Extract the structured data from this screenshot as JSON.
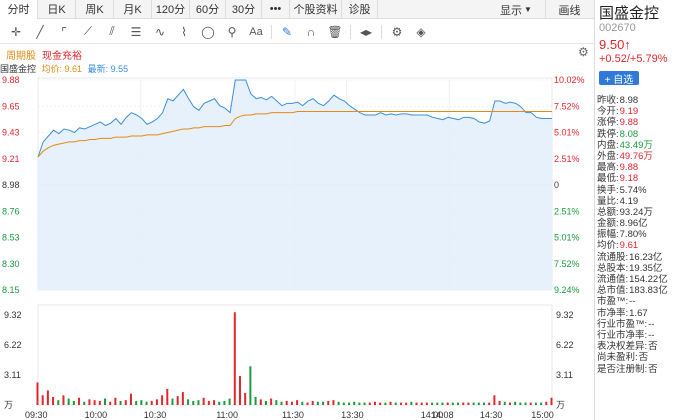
{
  "colors": {
    "up": "#e4262c",
    "down": "#1a9b3d",
    "price_line": "#3b8fdc",
    "avg_line": "#e58a17",
    "accent": "#2f7ad9"
  },
  "period_tabs": [
    {
      "label": "分时",
      "active": true
    },
    {
      "label": "日K"
    },
    {
      "label": "周K"
    },
    {
      "label": "月K"
    },
    {
      "label": "120分"
    },
    {
      "label": "60分"
    },
    {
      "label": "30分"
    },
    {
      "label": "•••"
    },
    {
      "label": "个股资料"
    },
    {
      "label": "诊股"
    }
  ],
  "display_menu": "显示",
  "draw_label": "画线",
  "toolbar_icons": [
    "crosshair-icon",
    "line-tool-icon",
    "rect-tool-icon",
    "fan-tool-icon",
    "parallel-tool-icon",
    "fib-tool-icon",
    "wave-tool-icon",
    "pen-tool-icon",
    "ellipse-tool-icon",
    "measure-tool-icon",
    "text-tool-icon",
    "highlighter-icon",
    "magnet-icon",
    "delete-icon",
    "flip-icon",
    "settings-icon",
    "layers-icon"
  ],
  "chart_head": {
    "tab1": "周期股",
    "tab2": "现金充裕",
    "gear": "⚙"
  },
  "legend": {
    "name": "国盛金控",
    "avg_label": "均价: 9.61",
    "latest_label": "最新: 9.55"
  },
  "chart_data": {
    "type": "line",
    "price_axis_left": [
      "9.88",
      "9.65",
      "9.43",
      "9.21",
      "8.98",
      "8.76",
      "8.53",
      "8.30",
      "8.15"
    ],
    "price_axis_right": [
      "10.02%",
      "7.52%",
      "5.01%",
      "2.51%",
      "0",
      "2.51%",
      "5.01%",
      "7.52%",
      "9.24%"
    ],
    "volume_axis": [
      "9.32",
      "6.22",
      "3.11",
      "万"
    ],
    "volume_axis_right": [
      "9.32",
      "6.22",
      "3.11",
      "万"
    ],
    "x_ticks": [
      "09:30",
      "10:00",
      "10:30",
      "11:00",
      "11:30",
      "13:30",
      "14:00",
      "14:08",
      "14:30",
      "15:00"
    ],
    "prev_close": 8.98,
    "ylim": [
      8.08,
      9.88
    ],
    "price_series": [
      9.22,
      9.35,
      9.4,
      9.45,
      9.42,
      9.46,
      9.45,
      9.43,
      9.47,
      9.46,
      9.48,
      9.5,
      9.52,
      9.49,
      9.51,
      9.55,
      9.5,
      9.56,
      9.6,
      9.58,
      9.55,
      9.5,
      9.52,
      9.55,
      9.6,
      9.72,
      9.7,
      9.75,
      9.8,
      9.72,
      9.65,
      9.62,
      9.68,
      9.7,
      9.72,
      9.66,
      9.64,
      9.6,
      9.88,
      9.88,
      9.88,
      9.76,
      9.72,
      9.73,
      9.71,
      9.74,
      9.7,
      9.66,
      9.68,
      9.68,
      9.69,
      9.66,
      9.7,
      9.72,
      9.68,
      9.66,
      9.7,
      9.75,
      9.72,
      9.7,
      9.66,
      9.63,
      9.6,
      9.58,
      9.58,
      9.58,
      9.6,
      9.58,
      9.59,
      9.58,
      9.59,
      9.59,
      9.58,
      9.58,
      9.58,
      9.58,
      9.56,
      9.55,
      9.54,
      9.56,
      9.55,
      9.54,
      9.56,
      9.56,
      9.55,
      9.52,
      9.51,
      9.53,
      9.7,
      9.7,
      9.68,
      9.69,
      9.68,
      9.65,
      9.6,
      9.6,
      9.56,
      9.55,
      9.55,
      9.55
    ],
    "avg_series": [
      9.22,
      9.27,
      9.3,
      9.32,
      9.33,
      9.34,
      9.35,
      9.35,
      9.36,
      9.36,
      9.37,
      9.37,
      9.38,
      9.38,
      9.38,
      9.39,
      9.39,
      9.39,
      9.4,
      9.4,
      9.4,
      9.41,
      9.41,
      9.41,
      9.42,
      9.43,
      9.44,
      9.45,
      9.46,
      9.46,
      9.47,
      9.47,
      9.48,
      9.48,
      9.48,
      9.48,
      9.49,
      9.49,
      9.55,
      9.57,
      9.58,
      9.58,
      9.59,
      9.59,
      9.59,
      9.6,
      9.6,
      9.6,
      9.6,
      9.6,
      9.61,
      9.61,
      9.61,
      9.61,
      9.61,
      9.61,
      9.61,
      9.61,
      9.61,
      9.61,
      9.61,
      9.61,
      9.61,
      9.61,
      9.61,
      9.61,
      9.61,
      9.61,
      9.61,
      9.61,
      9.61,
      9.61,
      9.61,
      9.61,
      9.61,
      9.61,
      9.61,
      9.61,
      9.61,
      9.61,
      9.61,
      9.61,
      9.61,
      9.61,
      9.61,
      9.61,
      9.61,
      9.61,
      9.61,
      9.61,
      9.61,
      9.61,
      9.61,
      9.61,
      9.61,
      9.61,
      9.61,
      9.61,
      9.61,
      9.61
    ],
    "volume_series": [
      2.8,
      1.2,
      1.8,
      1.0,
      0.6,
      1.2,
      0.8,
      0.5,
      0.9,
      0.4,
      0.7,
      0.6,
      0.5,
      0.8,
      0.4,
      0.9,
      0.5,
      0.6,
      1.4,
      0.5,
      0.6,
      0.4,
      0.5,
      0.7,
      1.2,
      2.0,
      0.8,
      1.1,
      1.6,
      0.7,
      0.5,
      0.6,
      0.9,
      0.5,
      0.6,
      0.4,
      0.5,
      0.8,
      11.5,
      3.6,
      1.5,
      4.8,
      1.0,
      0.7,
      0.5,
      0.8,
      0.6,
      0.4,
      0.5,
      0.4,
      0.6,
      0.4,
      0.3,
      0.5,
      0.4,
      0.4,
      0.5,
      0.6,
      0.4,
      0.3,
      0.3,
      0.4,
      0.3,
      0.3,
      0.3,
      0.4,
      0.3,
      0.3,
      0.4,
      0.3,
      0.3,
      0.3,
      0.4,
      0.3,
      0.3,
      0.3,
      0.3,
      0.3,
      0.3,
      0.3,
      0.3,
      0.3,
      0.3,
      0.3,
      0.3,
      0.3,
      0.3,
      0.3,
      1.2,
      0.5,
      0.4,
      0.3,
      0.4,
      0.3,
      0.3,
      0.3,
      0.3,
      0.3,
      0.4,
      0.9
    ],
    "volume_ylim": [
      0,
      12.4
    ]
  },
  "quote": {
    "name": "国盛金控",
    "code": "002670",
    "price": "9.50↑",
    "change": "+0.52/+5.79%",
    "watch_button": "+ 自选",
    "stats": [
      {
        "label": "昨收:",
        "value": "8.98",
        "cls": ""
      },
      {
        "label": "今开:",
        "value": "9.19",
        "cls": "red"
      },
      {
        "label": "涨停:",
        "value": "9.88",
        "cls": "red"
      },
      {
        "label": "跌停:",
        "value": "8.08",
        "cls": "green"
      },
      {
        "label": "内盘:",
        "value": "43.49万",
        "cls": "green"
      },
      {
        "label": "外盘:",
        "value": "49.76万",
        "cls": "red"
      },
      {
        "label": "最高:",
        "value": "9.88",
        "cls": "red"
      },
      {
        "label": "最低:",
        "value": "9.18",
        "cls": "red"
      },
      {
        "label": "换手:",
        "value": "5.74%",
        "cls": ""
      },
      {
        "label": "量比:",
        "value": "4.19",
        "cls": ""
      },
      {
        "label": "总额:",
        "value": "93.24万",
        "cls": ""
      },
      {
        "label": "金额:",
        "value": "8.96亿",
        "cls": ""
      },
      {
        "label": "振幅:",
        "value": "7.80%",
        "cls": ""
      },
      {
        "label": "均价:",
        "value": "9.61",
        "cls": "red"
      },
      {
        "label": "流通股:",
        "value": "16.23亿",
        "cls": ""
      },
      {
        "label": "总股本:",
        "value": "19.35亿",
        "cls": ""
      },
      {
        "label": "流通值:",
        "value": "154.22亿",
        "cls": ""
      },
      {
        "label": "总市值:",
        "value": "183.83亿",
        "cls": ""
      },
      {
        "label": "市盈™:",
        "value": "--",
        "cls": ""
      },
      {
        "label": "市净率:",
        "value": "1.67",
        "cls": ""
      },
      {
        "label": "行业市盈™:",
        "value": "--",
        "cls": ""
      },
      {
        "label": "行业市净率:",
        "value": "--",
        "cls": ""
      },
      {
        "label": "表决权差异:",
        "value": "否",
        "cls": ""
      },
      {
        "label": "尚未盈利:",
        "value": "否",
        "cls": ""
      },
      {
        "label": "是否注册制:",
        "value": "否",
        "cls": ""
      }
    ]
  }
}
